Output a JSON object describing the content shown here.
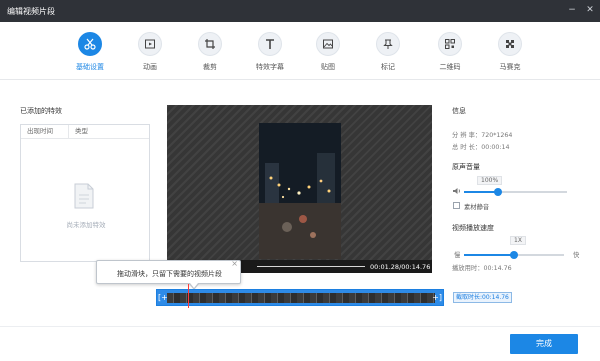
{
  "window": {
    "title": "编辑视频片段",
    "minimize": "−",
    "close": "✕"
  },
  "toolbar": {
    "items": [
      {
        "label": "基础设置",
        "icon": "scissors-icon",
        "active": true
      },
      {
        "label": "动画",
        "icon": "animation-icon",
        "active": false
      },
      {
        "label": "裁剪",
        "icon": "crop-icon",
        "active": false
      },
      {
        "label": "特效字幕",
        "icon": "text-icon",
        "active": false
      },
      {
        "label": "贴图",
        "icon": "image-icon",
        "active": false
      },
      {
        "label": "标记",
        "icon": "pin-icon",
        "active": false
      },
      {
        "label": "二维码",
        "icon": "qrcode-icon",
        "active": false
      },
      {
        "label": "马赛克",
        "icon": "mosaic-icon",
        "active": false
      }
    ]
  },
  "left_panel": {
    "title": "已添加的特效",
    "columns": [
      "出现时间",
      "类型"
    ],
    "empty_text": "尚未添加特效"
  },
  "player": {
    "time": "00:01.28/00:14.76"
  },
  "tooltip": {
    "text": "拖动滑块，只留下需要的视频片段",
    "close": "×"
  },
  "timeline": {
    "left_bracket": "[+",
    "right_bracket": "+]",
    "clip_duration": "截取时长:00:14.76"
  },
  "info": {
    "title": "信息",
    "resolution_label": "分 辨 率：",
    "resolution_value": "720*1264",
    "duration_label": "总 时 长：",
    "duration_value": "00:00:14",
    "audio_title": "原声音量",
    "volume_value": "100%",
    "volume_level": 0.33,
    "mute_label": "素材静音",
    "speed_title": "视频播放速度",
    "speed_value": "1X",
    "speed_slow": "慢",
    "speed_fast": "快",
    "speed_level": 0.5,
    "play_time_label": "播放用时：",
    "play_time_value": "00:14.76"
  },
  "footer": {
    "done_label": "完成"
  },
  "colors": {
    "accent": "#1c87e5",
    "titlebar": "#2f3238"
  }
}
